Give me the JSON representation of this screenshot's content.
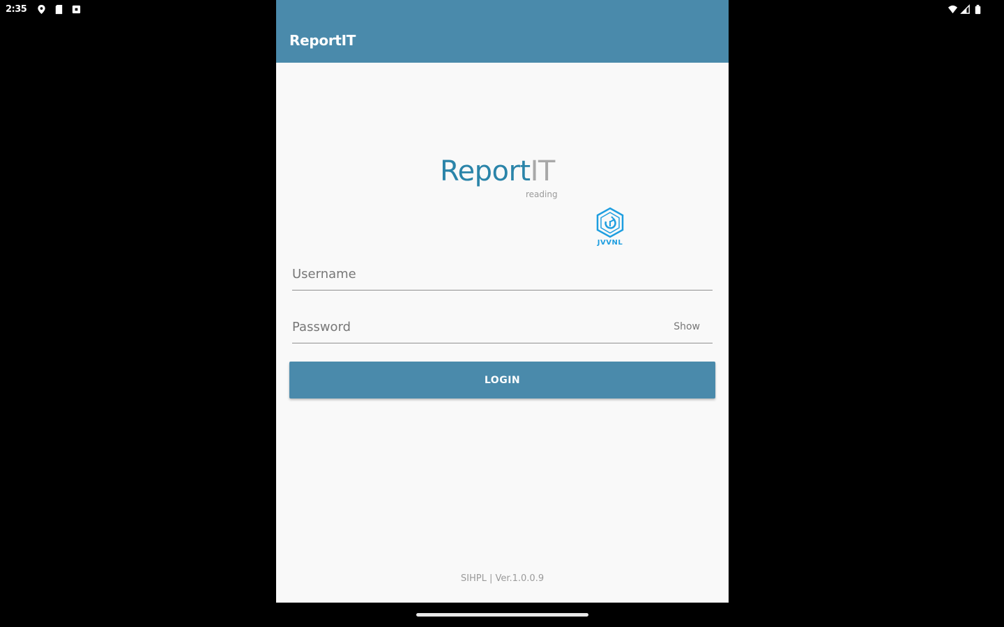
{
  "status_bar": {
    "time": "2:35",
    "left_icons": [
      "location-icon",
      "sd-card-icon",
      "screenshot-icon"
    ],
    "right_icons": [
      "wifi-icon",
      "cell-signal-icon",
      "battery-icon"
    ]
  },
  "app_bar": {
    "title": "ReportIT"
  },
  "logo": {
    "report": "Report",
    "it": "IT",
    "subtitle": "reading",
    "org": "JVVNL"
  },
  "form": {
    "username_placeholder": "Username",
    "password_placeholder": "Password",
    "show_label": "Show",
    "login_label": "LOGIN"
  },
  "footer": {
    "version": "SIHPL | Ver.1.0.0.9"
  },
  "colors": {
    "primary": "#4a8aab",
    "logo_blue": "#2a84a9",
    "jvvnl_blue": "#1e9ee0"
  }
}
